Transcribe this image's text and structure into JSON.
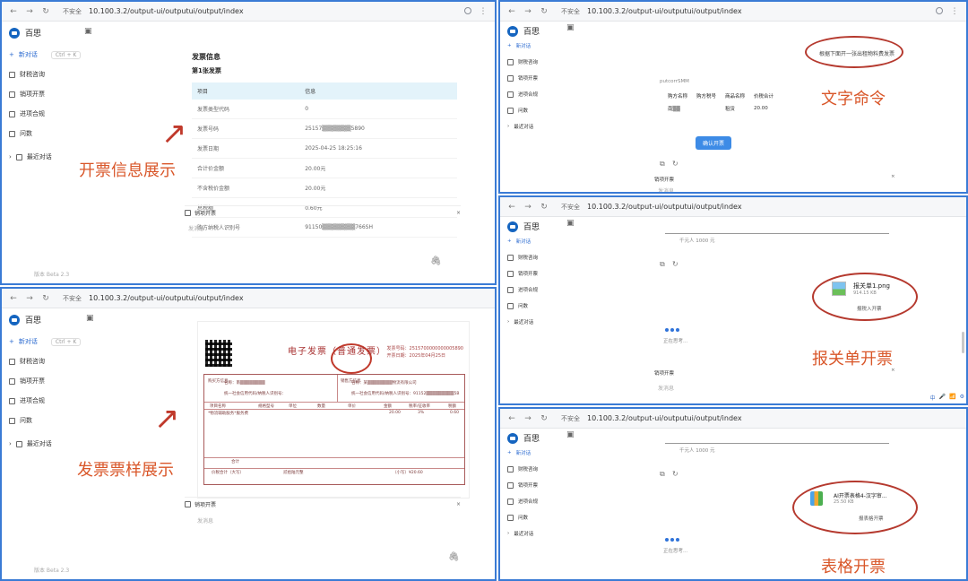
{
  "browser": {
    "insecure_label": "不安全",
    "url": "10.100.3.2/output-ui/outputui/output/index"
  },
  "app": {
    "name": "百思",
    "new_chat": "新对话",
    "new_chat_shortcut": "Ctrl + K",
    "nav": [
      "财税咨询",
      "销项开票",
      "进项合规",
      "问数"
    ],
    "recent": "最近对话",
    "version": "版本 Beta 2.3"
  },
  "panel_tl": {
    "title": "发票信息",
    "subtitle": "第1张发票",
    "headers": [
      "项目",
      "信息"
    ],
    "rows": [
      [
        "发票类型代码",
        "0"
      ],
      [
        "发票号码",
        "25157▒▒▒▒▒▒▒5890"
      ],
      [
        "发票日期",
        "2025-04-25 18:25:16"
      ],
      [
        "合计价金额",
        "20.00元"
      ],
      [
        "不含税价金额",
        "20.00元"
      ],
      [
        "总税额",
        "0.60元"
      ],
      [
        "购方纳税人识别号",
        "91150▒▒▒▒▒▒▒▒766SH"
      ]
    ],
    "task": "销项开票",
    "input_placeholder": "发消息",
    "label": "开票信息展示"
  },
  "panel_bl": {
    "invoice_title": "电子发票（普通发票）",
    "meta": [
      "发票号码：2515700000000005890",
      "开票日期：2025年04月25日"
    ],
    "buyer_label": "购买方信息",
    "seller_label": "销售方信息",
    "buyer_name": "名称：南▒▒▒▒▒▒▒▒",
    "seller_name": "名称：某▒▒▒▒▒▒▒▒物流有限公司",
    "buyer_tax_id": "统一社会信用代码/纳税人识别号：",
    "seller_tax_id": "统一社会信用代码/纳税人识别号：91152▒▒▒▒▒▒▒▒▒5B",
    "item_headers": [
      "项目名称",
      "规格型号",
      "单位",
      "数量",
      "单价",
      "金额",
      "税率/征收率",
      "税额"
    ],
    "item_row": [
      "*物流辅助服务*服务费",
      "",
      "",
      "",
      "",
      "20.00",
      "3%",
      "0.60"
    ],
    "total_label": "合计",
    "total_upper_label": "价税合计（大写）",
    "total_upper": "贰拾陆元整",
    "total_lower": "（小写）¥20.60",
    "task": "销项开票",
    "input_placeholder": "发消息",
    "label": "发票票样展示"
  },
  "panel_tr": {
    "user_command": "根据下面开一张出租物料费发票",
    "parsed_name": "putcorrSMM",
    "headers": [
      "购方名称",
      "购方税号",
      "商品名称",
      "价税合计"
    ],
    "row": [
      "南▒▒",
      "",
      "租赁",
      "20.00"
    ],
    "confirm_button": "确认开票",
    "task": "销项开票",
    "input_placeholder": "发消息",
    "label": "文字命令"
  },
  "panel_mr": {
    "file_name": "报关单1.png",
    "file_size": "914.15 KB",
    "file_action": "报税入开票",
    "thinking": "正在思考...",
    "scale_caption": "千元人  1000 元",
    "task": "销项开票",
    "input_placeholder": "发消息",
    "label": "报关单开票"
  },
  "panel_br": {
    "file_name": "AI开票表格4-汉字审...",
    "file_size": "25.50 KB",
    "file_action": "报表格开票",
    "thinking": "正在思考...",
    "scale_caption": "千元人  1000 元",
    "label": "表格开票"
  },
  "colors": {
    "panel_border": "#3a7bd5",
    "annotation": "#d9572a",
    "accent": "#1565c0",
    "table_header_bg": "#e3f3fa"
  }
}
